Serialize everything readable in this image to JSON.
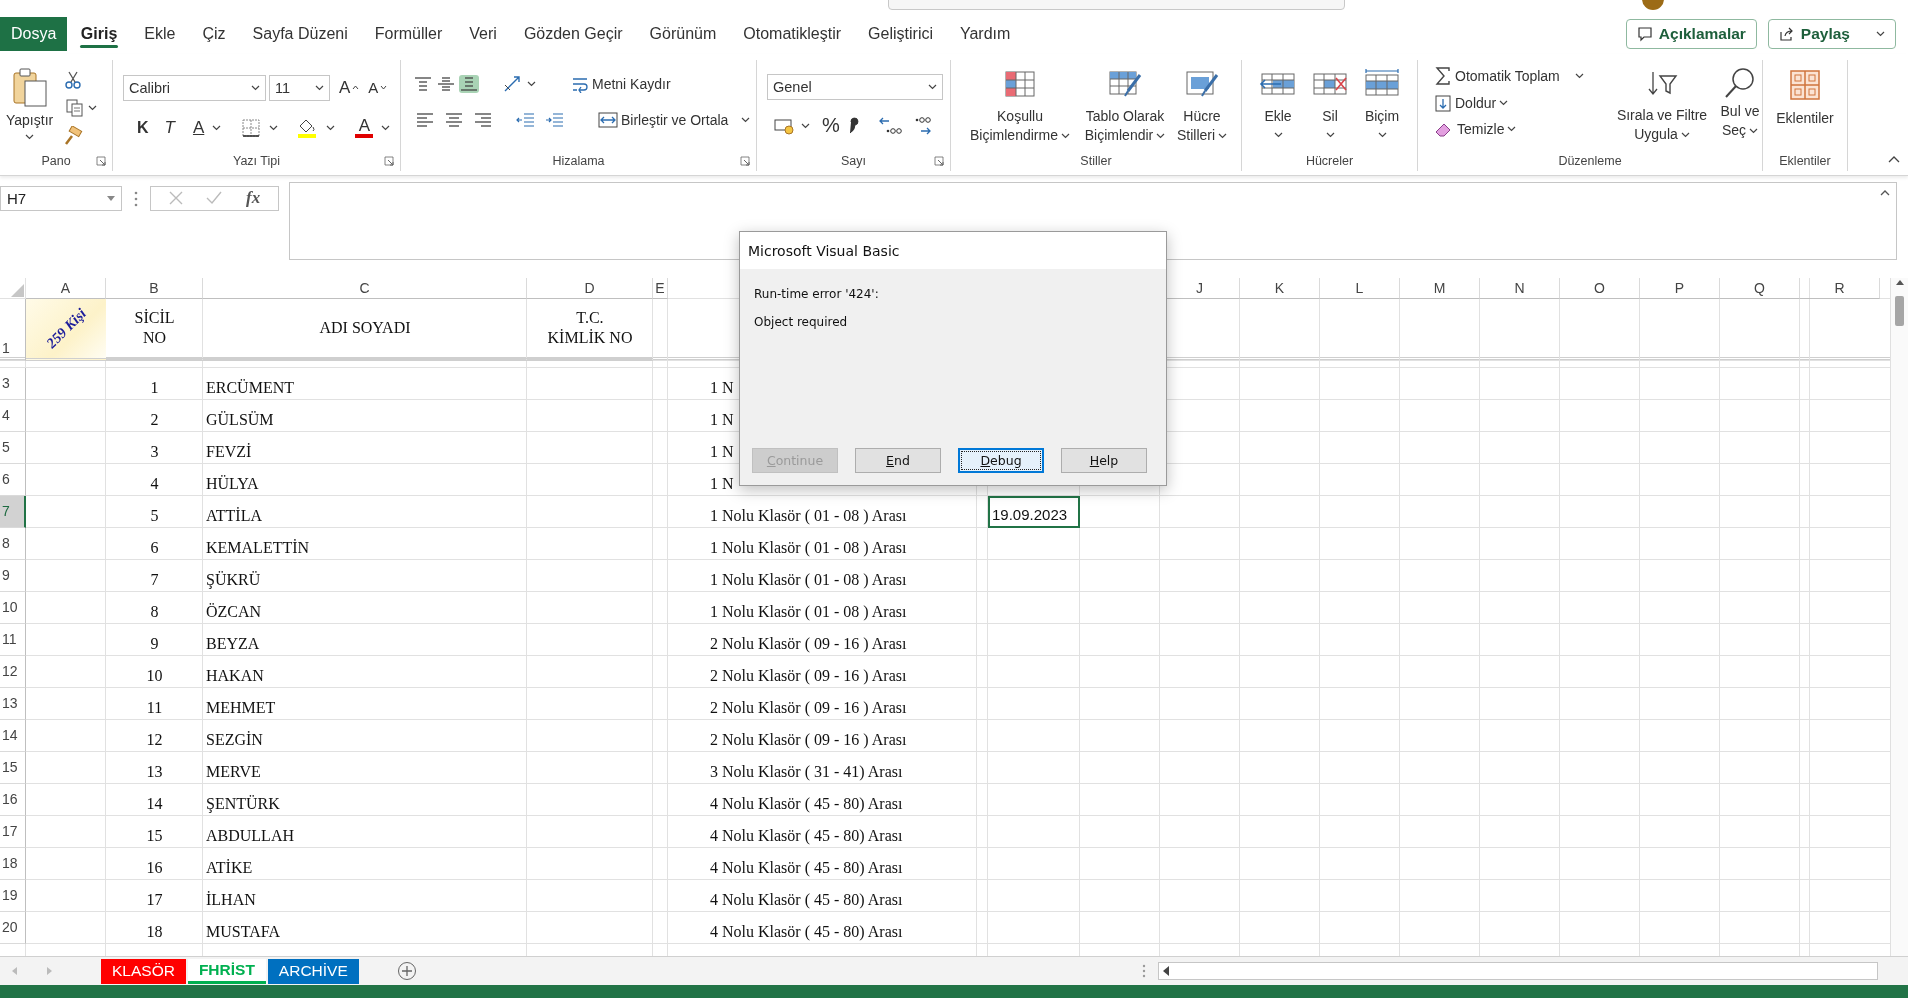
{
  "tabs": [
    {
      "label": "Dosya",
      "kind": "file",
      "selected": false
    },
    {
      "label": "Giriş",
      "kind": "tab",
      "selected": true
    },
    {
      "label": "Ekle",
      "kind": "tab",
      "selected": false
    },
    {
      "label": "Çiz",
      "kind": "tab",
      "selected": false
    },
    {
      "label": "Sayfa Düzeni",
      "kind": "tab",
      "selected": false
    },
    {
      "label": "Formüller",
      "kind": "tab",
      "selected": false
    },
    {
      "label": "Veri",
      "kind": "tab",
      "selected": false
    },
    {
      "label": "Gözden Geçir",
      "kind": "tab",
      "selected": false
    },
    {
      "label": "Görünüm",
      "kind": "tab",
      "selected": false
    },
    {
      "label": "Otomatikleştir",
      "kind": "tab",
      "selected": false
    },
    {
      "label": "Geliştirici",
      "kind": "tab",
      "selected": false
    },
    {
      "label": "Yardım",
      "kind": "tab",
      "selected": false
    }
  ],
  "tab_actions": [
    {
      "label": "Açıklamalar",
      "kind": "comments"
    },
    {
      "label": "Paylaş",
      "kind": "share"
    }
  ],
  "ribbon": {
    "groups": [
      {
        "kind": "clipboard",
        "label": "Pano",
        "paste": "Yapıştır"
      },
      {
        "kind": "font",
        "label": "Yazı Tipi",
        "font": "Calibri",
        "size": "11",
        "grow": "A",
        "shrink": "A",
        "bold": "K",
        "italic": "T",
        "underline": "A",
        "font_color": "A"
      },
      {
        "kind": "alignment",
        "label": "Hizalama",
        "wrap": "Metni Kaydır",
        "merge": "Birleştir ve Ortala",
        "vertical_align": [
          {
            "selected": false
          },
          {
            "selected": false
          },
          {
            "selected": true
          }
        ]
      },
      {
        "kind": "number",
        "label": "Sayı",
        "format": "Genel",
        "percent": "%"
      },
      {
        "kind": "styles",
        "label": "Stiller",
        "buttons": [
          "Koşullu\nBiçimlendirme",
          "Tablo Olarak\nBiçimlendir",
          "Hücre\nStilleri"
        ]
      },
      {
        "kind": "cells",
        "label": "Hücreler",
        "buttons": [
          "Ekle",
          "Sil",
          "Biçim"
        ]
      },
      {
        "kind": "editing",
        "label": "Düzenleme",
        "autosum": "Otomatik Toplam",
        "fill": "Doldur",
        "clear": "Temizle",
        "sort": "Sırala ve Filtre\nUygula",
        "find": "Bul ve\nSeç"
      },
      {
        "kind": "addins",
        "label": "Eklentiler",
        "button": "Eklentiler"
      }
    ]
  },
  "formula_bar": {
    "name_box": "H7",
    "function_label": "fx"
  },
  "sheet": {
    "column_headers": [
      "A",
      "B",
      "C",
      "D",
      "E",
      "J",
      "K",
      "L",
      "M",
      "N",
      "O",
      "P",
      "Q",
      "R"
    ],
    "header_row": {
      "number": "1",
      "a1": "259 Kişi",
      "sicil": "SİCİL\nNO",
      "name": "ADI SOYADI",
      "id": "T.C.\nKİMLİK NO"
    },
    "rows": [
      {
        "number": "3",
        "sicil": "1",
        "name": "ERCÜMENT",
        "folder": "1 N",
        "selected": false
      },
      {
        "number": "4",
        "sicil": "2",
        "name": "GÜLSÜM",
        "folder": "1 N",
        "selected": false
      },
      {
        "number": "5",
        "sicil": "3",
        "name": "FEVZİ",
        "folder": "1 N",
        "selected": false
      },
      {
        "number": "6",
        "sicil": "4",
        "name": "HÜLYA",
        "folder": "1 N",
        "selected": false
      },
      {
        "number": "7",
        "sicil": "5",
        "name": "ATTİLA",
        "folder": "1 Nolu Klasör ( 01 - 08 ) Arası",
        "date": "19.09.2023",
        "selected": true
      },
      {
        "number": "8",
        "sicil": "6",
        "name": "KEMALETTİN",
        "folder": "1 Nolu Klasör ( 01 - 08 ) Arası",
        "selected": false
      },
      {
        "number": "9",
        "sicil": "7",
        "name": "ŞÜKRÜ",
        "folder": "1 Nolu Klasör ( 01 - 08 ) Arası",
        "selected": false
      },
      {
        "number": "10",
        "sicil": "8",
        "name": "ÖZCAN",
        "folder": "1 Nolu Klasör ( 01 - 08 ) Arası",
        "selected": false
      },
      {
        "number": "11",
        "sicil": "9",
        "name": "BEYZA",
        "folder": "2 Nolu Klasör ( 09 - 16 ) Arası",
        "selected": false
      },
      {
        "number": "12",
        "sicil": "10",
        "name": "HAKAN",
        "folder": "2 Nolu Klasör ( 09 - 16 ) Arası",
        "selected": false
      },
      {
        "number": "13",
        "sicil": "11",
        "name": "MEHMET",
        "folder": "2 Nolu Klasör ( 09 - 16 ) Arası",
        "selected": false
      },
      {
        "number": "14",
        "sicil": "12",
        "name": "SEZGİN",
        "folder": "2 Nolu Klasör ( 09 - 16 ) Arası",
        "selected": false
      },
      {
        "number": "15",
        "sicil": "13",
        "name": "MERVE",
        "folder": "3 Nolu Klasör ( 31 - 41) Arası",
        "selected": false
      },
      {
        "number": "16",
        "sicil": "14",
        "name": "ŞENTÜRK",
        "folder": "4 Nolu Klasör ( 45 - 80) Arası",
        "selected": false
      },
      {
        "number": "17",
        "sicil": "15",
        "name": "ABDULLAH",
        "folder": "4 Nolu Klasör ( 45 - 80) Arası",
        "selected": false
      },
      {
        "number": "18",
        "sicil": "16",
        "name": "ATİKE",
        "folder": "4 Nolu Klasör ( 45 - 80) Arası",
        "selected": false
      },
      {
        "number": "19",
        "sicil": "17",
        "name": "İLHAN",
        "folder": "4 Nolu Klasör ( 45 - 80) Arası",
        "selected": false
      },
      {
        "number": "20",
        "sicil": "18",
        "name": "MUSTAFA",
        "folder": "4 Nolu Klasör ( 45 - 80) Arası",
        "selected": false
      }
    ]
  },
  "dialog": {
    "title": "Microsoft Visual Basic",
    "error": "Run-time error '424':",
    "message": "Object required",
    "buttons": [
      {
        "label": "Continue",
        "disabled": true,
        "focused": false
      },
      {
        "label": "End",
        "disabled": false,
        "focused": false
      },
      {
        "label": "Debug",
        "disabled": false,
        "focused": true
      },
      {
        "label": "Help",
        "disabled": false,
        "focused": false
      }
    ]
  },
  "sheet_tabs": [
    {
      "label": "KLASÖR",
      "color": "#ff0000",
      "selected": false
    },
    {
      "label": "FHRİST",
      "color": "#00b050",
      "selected": true
    },
    {
      "label": "ARCHİVE",
      "color": "#0070c0",
      "selected": false
    }
  ]
}
